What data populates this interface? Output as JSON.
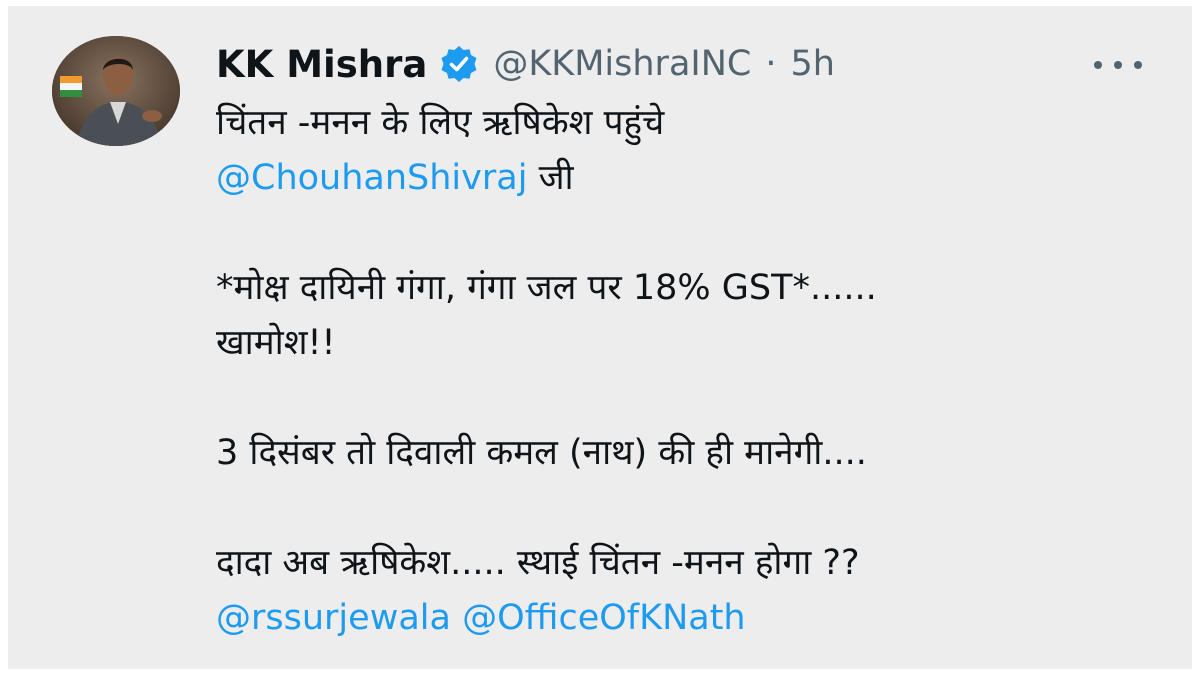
{
  "tweet": {
    "author_name": "KK Mishra",
    "author_handle": "@KKMishraINC",
    "separator": "·",
    "time": "5h",
    "lines": {
      "l1": "चिंतन -मनन के लिए ऋषिकेश पहुंचे",
      "mention1": "@ChouhanShivraj",
      "l2_suffix": " जी",
      "l3": "*मोक्ष दायिनी गंगा, गंगा जल पर 18% GST*......",
      "l4": "खामोश!!",
      "l5": "3 दिसंबर तो दिवाली कमल (नाथ) की ही मानेगी....",
      "l6": "दादा अब ऋषिकेश..... स्थाई चिंतन -मनन होगा ??",
      "mention2": "@rssurjewala",
      "mention3": "@OfficeOfKNath"
    }
  },
  "colors": {
    "background": "#ededed",
    "text": "#0f1419",
    "secondary": "#536471",
    "link": "#1d9bf0",
    "verified": "#1d9bf0"
  }
}
